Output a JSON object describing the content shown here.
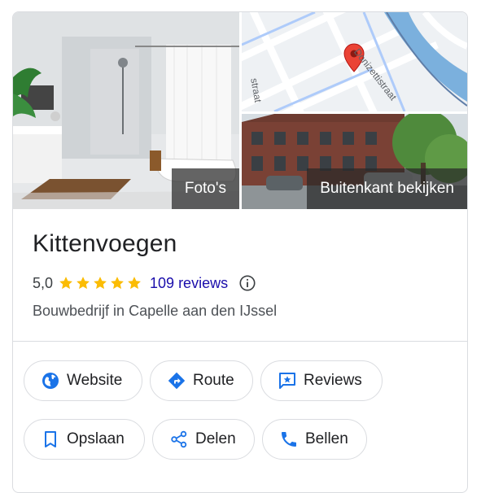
{
  "photos": {
    "photos_label": "Foto's",
    "streetview_label": "Buitenkant bekijken",
    "map_street_1": "Donizettistraat",
    "map_street_2": "straat"
  },
  "business": {
    "name": "Kittenvoegen",
    "rating": "5,0",
    "stars_count": 5,
    "reviews_label": "109 reviews",
    "category": "Bouwbedrijf in Capelle aan den IJssel"
  },
  "actions": {
    "website": "Website",
    "route": "Route",
    "reviews": "Reviews",
    "save": "Opslaan",
    "share": "Delen",
    "call": "Bellen"
  },
  "colors": {
    "accent_blue": "#1a73e8",
    "link_blue": "#1a0dab",
    "star_yellow": "#fbbc04",
    "pin_red": "#ea4335"
  },
  "icons": {
    "website": "globe-icon",
    "route": "directions-icon",
    "reviews": "review-star-icon",
    "save": "bookmark-icon",
    "share": "share-icon",
    "call": "phone-icon",
    "info": "info-icon"
  }
}
